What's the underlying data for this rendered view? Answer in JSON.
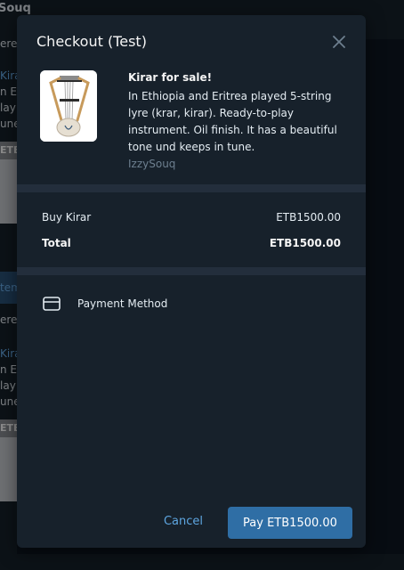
{
  "background": {
    "header_title": "Souq",
    "messages": [
      {
        "text": "ere"
      },
      {
        "title": "Kirar",
        "lines": [
          "n Eth",
          "lay",
          "une"
        ],
        "chip": "ETB"
      },
      {
        "link": "tem"
      },
      {
        "text": "ere"
      },
      {
        "title": "Kirar",
        "lines": [
          "n Eth",
          "lay",
          "une"
        ],
        "chip": "ETB"
      }
    ]
  },
  "modal": {
    "title": "Checkout (Test)",
    "close_icon": "close-icon",
    "product": {
      "image_icon": "kirar-lyre-image",
      "title": "Kirar for sale!",
      "description": "In Ethiopia and Eritrea played 5-string lyre (krar, kirar). Ready-to-play instrument. Oil finish. It has a beautiful tone und keeps in tune.",
      "seller": "IzzySouq"
    },
    "summary": {
      "item_label": "Buy Kirar",
      "item_price": "ETB1500.00",
      "total_label": "Total",
      "total_price": "ETB1500.00"
    },
    "payment": {
      "icon": "credit-card-icon",
      "label": "Payment Method"
    },
    "buttons": {
      "cancel": "Cancel",
      "pay": "Pay ETB1500.00"
    }
  },
  "colors": {
    "modal_bg": "#17212b",
    "accent": "#2f6ea5",
    "link": "#5ea6e1",
    "muted": "#6d7f8f"
  }
}
